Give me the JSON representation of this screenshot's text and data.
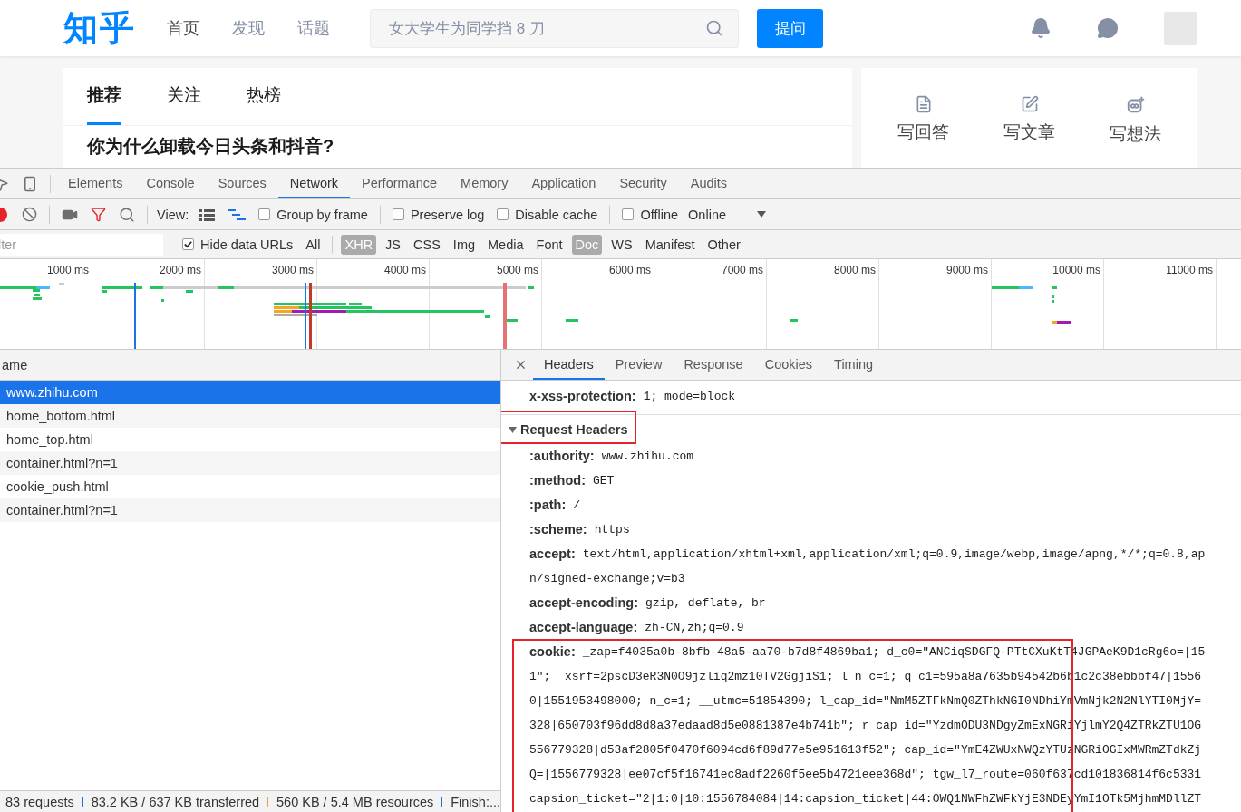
{
  "site": {
    "logo": "知乎",
    "nav": [
      {
        "label": "首页",
        "selected": true
      },
      {
        "label": "发现",
        "selected": false
      },
      {
        "label": "话题",
        "selected": false
      }
    ],
    "search": {
      "placeholder": "女大学生为同学挡 8 刀"
    },
    "ask_button": "提问"
  },
  "feed": {
    "tabs": [
      {
        "label": "推荐",
        "selected": true
      },
      {
        "label": "关注",
        "selected": false
      },
      {
        "label": "热榜",
        "selected": false
      }
    ],
    "first_title": "你为什么卸载今日头条和抖音?"
  },
  "side": {
    "actions": [
      {
        "label": "写回答",
        "kind": "answer"
      },
      {
        "label": "写文章",
        "kind": "article"
      },
      {
        "label": "写想法",
        "kind": "idea"
      }
    ]
  },
  "devtools": {
    "panels": [
      {
        "label": "Elements",
        "selected": false
      },
      {
        "label": "Console",
        "selected": false
      },
      {
        "label": "Sources",
        "selected": false
      },
      {
        "label": "Network",
        "selected": true
      },
      {
        "label": "Performance",
        "selected": false
      },
      {
        "label": "Memory",
        "selected": false
      },
      {
        "label": "Application",
        "selected": false
      },
      {
        "label": "Security",
        "selected": false
      },
      {
        "label": "Audits",
        "selected": false
      }
    ],
    "toolbar": {
      "view_label": "View:",
      "options": [
        {
          "label": "Group by frame",
          "checked": false
        },
        {
          "label": "Preserve log",
          "checked": false
        },
        {
          "label": "Disable cache",
          "checked": false
        },
        {
          "label": "Offline",
          "checked": false
        }
      ],
      "throttling": "Online"
    },
    "filter": {
      "placeholder": "lter",
      "hide_data_urls": {
        "label": "Hide data URLs",
        "checked": true
      },
      "all": "All",
      "types": [
        {
          "label": "XHR",
          "selected": true
        },
        {
          "label": "JS",
          "selected": false
        },
        {
          "label": "CSS",
          "selected": false
        },
        {
          "label": "Img",
          "selected": false
        },
        {
          "label": "Media",
          "selected": false
        },
        {
          "label": "Font",
          "selected": false
        },
        {
          "label": "Doc",
          "selected": true
        },
        {
          "label": "WS",
          "selected": false
        },
        {
          "label": "Manifest",
          "selected": false
        },
        {
          "label": "Other",
          "selected": false
        }
      ]
    },
    "timeline": {
      "ticks": [
        "1000 ms",
        "2000 ms",
        "3000 ms",
        "4000 ms",
        "5000 ms",
        "6000 ms",
        "7000 ms",
        "8000 ms",
        "9000 ms",
        "10000 ms",
        "11000 ms"
      ]
    },
    "requests": {
      "column": "ame",
      "rows": [
        {
          "name": "www.zhihu.com",
          "selected": true
        },
        {
          "name": "home_bottom.html",
          "selected": false
        },
        {
          "name": "home_top.html",
          "selected": false
        },
        {
          "name": "container.html?n=1",
          "selected": false
        },
        {
          "name": "cookie_push.html",
          "selected": false
        },
        {
          "name": "container.html?n=1",
          "selected": false
        }
      ]
    },
    "detail": {
      "tabs": [
        {
          "label": "Headers",
          "selected": true
        },
        {
          "label": "Preview",
          "selected": false
        },
        {
          "label": "Response",
          "selected": false
        },
        {
          "label": "Cookies",
          "selected": false
        },
        {
          "label": "Timing",
          "selected": false
        }
      ],
      "response_tail": {
        "name": "x-xss-protection:",
        "lines": [
          "1; mode=block"
        ]
      },
      "section": {
        "title": "Request Headers",
        "expanded": true,
        "highlighted": true
      },
      "headers": [
        {
          "name": ":authority:",
          "lines": [
            "www.zhihu.com"
          ],
          "highlighted": false
        },
        {
          "name": ":method:",
          "lines": [
            "GET"
          ],
          "highlighted": false
        },
        {
          "name": ":path:",
          "lines": [
            "/"
          ],
          "highlighted": false
        },
        {
          "name": ":scheme:",
          "lines": [
            "https"
          ],
          "highlighted": false
        },
        {
          "name": "accept:",
          "lines": [
            "text/html,application/xhtml+xml,application/xml;q=0.9,image/webp,image/apng,*/*;q=0.8,ap",
            "n/signed-exchange;v=b3"
          ],
          "highlighted": false
        },
        {
          "name": "accept-encoding:",
          "lines": [
            "gzip, deflate, br"
          ],
          "highlighted": false
        },
        {
          "name": "accept-language:",
          "lines": [
            "zh-CN,zh;q=0.9"
          ],
          "highlighted": false
        },
        {
          "name": "cookie:",
          "lines": [
            "_zap=f4035a0b-8bfb-48a5-aa70-b7d8f4869ba1; d_c0=\"ANCiqSDGFQ-PTtCXuKtT4JGPAeK9D1cRg6o=|15",
            "1\"; _xsrf=2pscD3eR3N0O9jzliq2mz10TV2GgjiS1; l_n_c=1; q_c1=595a8a7635b94542b6b1c2c38ebbbf47|1556",
            "0|1551953498000; n_c=1; __utmc=51854390; l_cap_id=\"NmM5ZTFkNmQ0ZThkNGI0NDhiYmVmNjk2N2NlYTI0MjY=",
            "328|650703f96dd8d8a37edaad8d5e0881387e4b741b\"; r_cap_id=\"YzdmODU3NDgyZmExNGRiYjlmY2Q4ZTRkZTU1OG",
            "556779328|d53af2805f0470f6094cd6f89d77e5e951613f52\"; cap_id=\"YmE4ZWUxNWQzYTUzNGRiOGIxMWRmZTdkZj",
            "Q=|1556779328|ee07cf5f16741ec8adf2260f5ee5b4721eee368d\"; tgw_l7_route=060f637cd101836814f6c5331",
            "capsion_ticket=\"2|1:0|10:1556784084|14:capsion_ticket|44:OWQ1NWFhZWFkYjE3NDEyYmI1OTk5MjhmMDllZT"
          ],
          "highlighted": true
        }
      ]
    },
    "status": [
      "83 requests",
      "83.2 KB / 637 KB transferred",
      "560 KB / 5.4 MB resources",
      "Finish:..."
    ]
  }
}
